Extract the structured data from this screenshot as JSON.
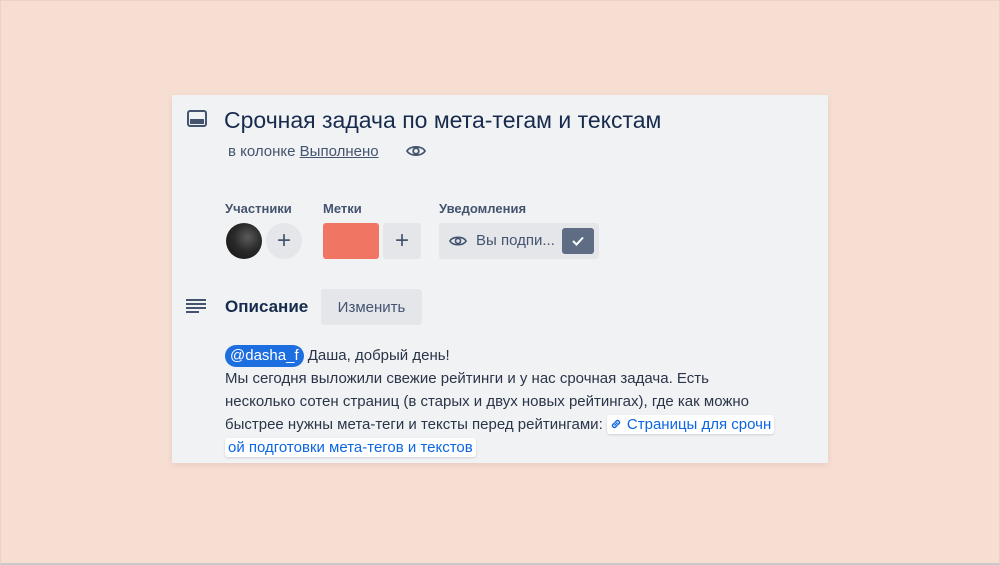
{
  "card": {
    "title": "Срочная задача по мета-тегам и текстам",
    "list_prefix": "в колонке ",
    "list_name": "Выполнено"
  },
  "members": {
    "label": "Участники",
    "add": "+"
  },
  "labels": {
    "label": "Метки",
    "add": "+",
    "colors": [
      "#f07562"
    ]
  },
  "notifications": {
    "label": "Уведомления",
    "watch_text": "Вы подпи..."
  },
  "description": {
    "title": "Описание",
    "edit_label": "Изменить",
    "mention": "@dasha_f",
    "greeting": " Даша, добрый день!",
    "line1": "Мы сегодня выложили свежие рейтинги и у нас срочная задача. Есть",
    "line2": "несколько сотен страниц (в старых и двух новых рейтингах), где как можно",
    "line3": "быстрее нужны мета-теги и тексты перед рейтингами: ",
    "link_text_part1": "Страницы для срочн",
    "link_text_part2": "ой подготовки мета-тегов и текстов"
  },
  "colors": {
    "background": "#f7ded2",
    "card": "#f1f2f4",
    "mention": "#1d6fe0",
    "link": "#0c66e4",
    "label_red": "#f07562"
  },
  "icons": [
    "card-icon",
    "eye-icon",
    "description-icon",
    "check-icon",
    "link-icon"
  ]
}
